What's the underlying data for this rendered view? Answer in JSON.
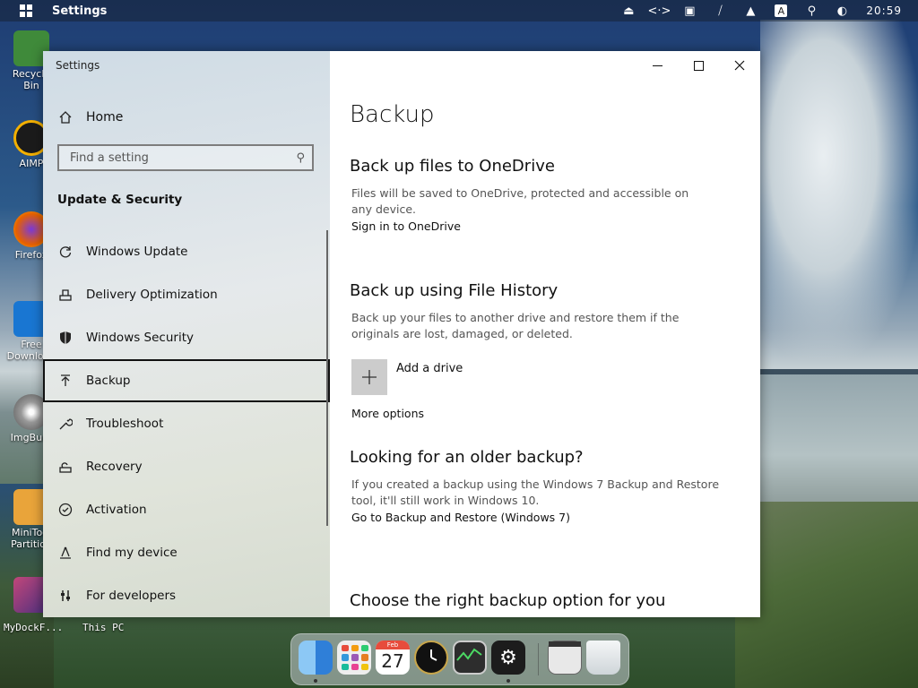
{
  "topbar": {
    "app_title": "Settings",
    "clock": "20:59",
    "tray_icons": [
      "eject-icon",
      "code-icon",
      "display-icon",
      "network-off-icon",
      "eject-up-icon",
      "keyboard-a-icon",
      "search-icon",
      "toggle-icon"
    ],
    "keyboard_label": "A"
  },
  "desktop": {
    "icons": [
      {
        "label": "Recycle Bin",
        "icon": "recycle-bin-icon",
        "color": "#3f8a3a"
      },
      {
        "label": "AIMP",
        "icon": "aimp-icon",
        "color": "#1b1b1b"
      },
      {
        "label": "Firefox",
        "icon": "firefox-icon",
        "color": "#e66000"
      },
      {
        "label": "Free Download",
        "icon": "download-app-icon",
        "color": "#1976d2"
      },
      {
        "label": "ImgBurn",
        "icon": "imgburn-icon",
        "color": "#888888"
      },
      {
        "label": "MiniTool Partition",
        "icon": "minitool-icon",
        "color": "#e9a43a"
      },
      {
        "label": "MyDockF...",
        "icon": "mydock-icon",
        "color": "#7a3a8a"
      }
    ],
    "this_pc_label": "This PC",
    "mydock_label": "MyDockF..."
  },
  "window": {
    "title": "Settings",
    "controls": {
      "minimize": "minimize-button",
      "maximize": "maximize-button",
      "close": "close-button"
    }
  },
  "sidebar": {
    "home_label": "Home",
    "search_placeholder": "Find a setting",
    "section_title": "Update & Security",
    "items": [
      {
        "label": "Windows Update",
        "icon": "refresh-icon",
        "active": false
      },
      {
        "label": "Delivery Optimization",
        "icon": "delivery-icon",
        "active": false
      },
      {
        "label": "Windows Security",
        "icon": "shield-icon",
        "active": false
      },
      {
        "label": "Backup",
        "icon": "backup-arrow-icon",
        "active": true
      },
      {
        "label": "Troubleshoot",
        "icon": "wrench-icon",
        "active": false
      },
      {
        "label": "Recovery",
        "icon": "recovery-icon",
        "active": false
      },
      {
        "label": "Activation",
        "icon": "check-circle-icon",
        "active": false
      },
      {
        "label": "Find my device",
        "icon": "find-device-icon",
        "active": false
      },
      {
        "label": "For developers",
        "icon": "developer-icon",
        "active": false
      }
    ]
  },
  "content": {
    "page_title": "Backup",
    "onedrive": {
      "heading": "Back up files to OneDrive",
      "description": "Files will be saved to OneDrive, protected and accessible on any device.",
      "link": "Sign in to OneDrive"
    },
    "file_history": {
      "heading": "Back up using File History",
      "description": "Back up your files to another drive and restore them if the originals are lost, damaged, or deleted.",
      "add_drive": "Add a drive",
      "more_options": "More options"
    },
    "older_backup": {
      "heading": "Looking for an older backup?",
      "description": "If you created a backup using the Windows 7 Backup and Restore tool, it'll still work in Windows 10.",
      "link": "Go to Backup and Restore (Windows 7)"
    },
    "choose": {
      "heading": "Choose the right backup option for you"
    }
  },
  "dock": {
    "items": [
      {
        "name": "finder-icon",
        "color": "#3a8ee6",
        "running": true
      },
      {
        "name": "launchpad-icon",
        "color": "#f1f1f1",
        "running": false
      },
      {
        "name": "calendar-icon",
        "color": "#ffffff",
        "running": false
      },
      {
        "name": "clock-icon",
        "color": "#111111",
        "running": false
      },
      {
        "name": "activity-monitor-icon",
        "color": "#2d2d2d",
        "running": false
      },
      {
        "name": "settings-gear-icon",
        "color": "#1c1c1c",
        "running": true
      },
      {
        "name": "window-preview-icon",
        "color": "#e8e8e8",
        "running": false
      },
      {
        "name": "trash-icon",
        "color": "#dfe3e6",
        "running": false
      }
    ],
    "calendar_month": "Feb",
    "calendar_day": "27"
  }
}
